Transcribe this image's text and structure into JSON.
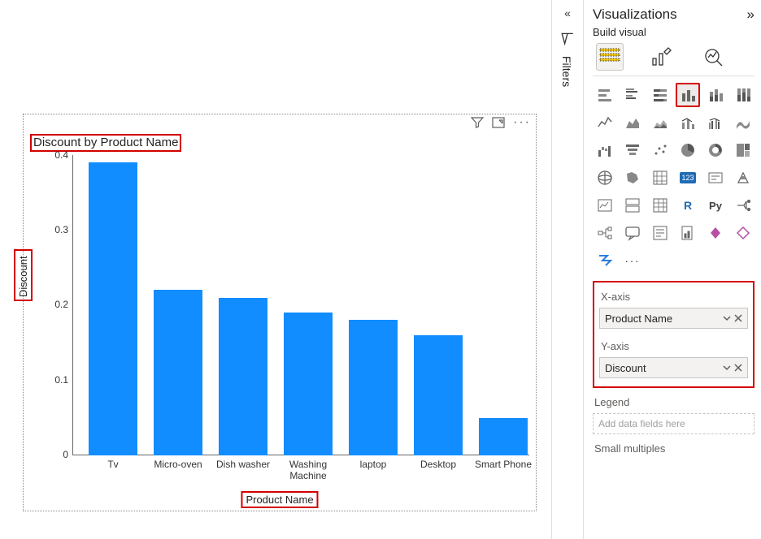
{
  "chart_data": {
    "type": "bar",
    "title": "Discount by Product Name",
    "xlabel": "Product Name",
    "ylabel": "Discount",
    "ylim": [
      0,
      0.4
    ],
    "yticks": [
      0.0,
      0.1,
      0.2,
      0.3,
      0.4
    ],
    "categories": [
      "Tv",
      "Micro-oven",
      "Dish washer",
      "Washing Machine",
      "laptop",
      "Desktop",
      "Smart Phone"
    ],
    "values": [
      0.39,
      0.22,
      0.21,
      0.19,
      0.18,
      0.16,
      0.05
    ]
  },
  "filters": {
    "label": "Filters"
  },
  "viz": {
    "title": "Visualizations",
    "subtitle": "Build visual",
    "grid": [
      "stacked-bar-h",
      "clustered-bar-h",
      "stacked-bar-h-100",
      "clustered-column",
      "stacked-column",
      "stacked-column-100",
      "line",
      "area",
      "stacked-area",
      "line-stacked-column",
      "line-clustered-column",
      "ribbon",
      "waterfall",
      "funnel",
      "scatter",
      "pie",
      "donut",
      "treemap",
      "map",
      "filled-map",
      "azure-map",
      "gauge",
      "card",
      "multi-row-card",
      "kpi",
      "slicer",
      "table",
      "r-visual",
      "py-visual",
      "key-influencers",
      "decomposition-tree",
      "qa",
      "narrative",
      "paginated",
      "power-apps",
      "get-more",
      "power-automate",
      "more"
    ],
    "selected_index": 3,
    "fields": {
      "xaxis_label": "X-axis",
      "xaxis_value": "Product Name",
      "yaxis_label": "Y-axis",
      "yaxis_value": "Discount"
    },
    "legend_label": "Legend",
    "legend_placeholder": "Add data fields here",
    "small_multiples_label": "Small multiples"
  }
}
